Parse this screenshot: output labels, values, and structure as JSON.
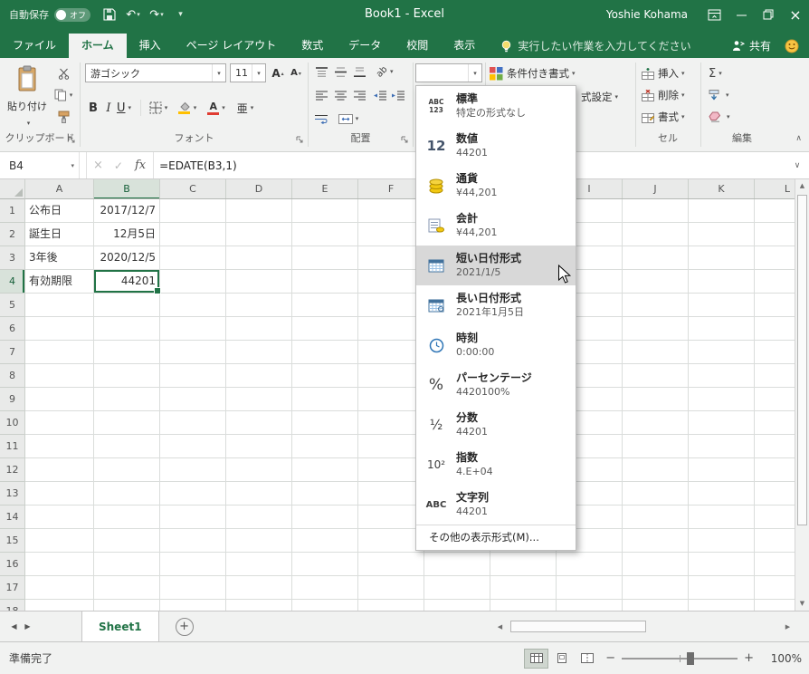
{
  "colors": {
    "excel_green": "#217346",
    "ribbon_bg": "#f1f2f1",
    "menu_highlight": "#d8d8d8",
    "selected_header_bg": "#d8e2da",
    "selected_cell_border": "#217346",
    "grid_line": "#dadddb"
  },
  "title_bar": {
    "autosave_label": "自動保存",
    "autosave_state": "オフ",
    "title": "Book1 - Excel",
    "user_name": "Yoshie Kohama"
  },
  "ribbon_tabs": {
    "file": "ファイル",
    "tabs": [
      "ホーム",
      "挿入",
      "ページ レイアウト",
      "数式",
      "データ",
      "校閲",
      "表示"
    ],
    "active_tab": "ホーム",
    "tell_me": "実行したい作業を入力してください",
    "share": "共有"
  },
  "ribbon": {
    "clipboard": {
      "group_label": "クリップボード",
      "paste_label": "貼り付け"
    },
    "font": {
      "group_label": "フォント",
      "font_name": "游ゴシック",
      "font_size": "11",
      "bold": "B",
      "italic": "I",
      "underline": "U",
      "phonetic": "亜"
    },
    "alignment": {
      "group_label": "配置",
      "orientation": "ab"
    },
    "number": {
      "format_value": ""
    },
    "styles": {
      "conditional_formatting": "条件付き書式",
      "format_as_table_truncated": "式設定"
    },
    "cells": {
      "group_label": "セル",
      "insert": "挿入",
      "delete": "削除",
      "format": "書式"
    },
    "editing": {
      "group_label": "編集",
      "autosum": "Σ"
    },
    "collapse": "∧"
  },
  "formula_bar": {
    "name_box": "B4",
    "fx": "fx",
    "formula": "=EDATE(B3,1)"
  },
  "grid": {
    "columns": [
      "A",
      "B",
      "C",
      "D",
      "E",
      "F",
      "G",
      "H",
      "I",
      "J",
      "K",
      "L"
    ],
    "visible_rows": 18,
    "selected_cell": "B4",
    "selected_column": "B",
    "selected_row": 4,
    "cells": {
      "A1": "公布日",
      "B1": "2017/12/7",
      "A2": "誕生日",
      "B2": "12月5日",
      "A3": "3年後",
      "B3": "2020/12/5",
      "A4": "有効期限",
      "B4": "44201"
    },
    "right_aligned": [
      "B1",
      "B2",
      "B3",
      "B4"
    ]
  },
  "number_format_menu": {
    "items": [
      {
        "icon": "general-icon",
        "glyph": "ABC\n123",
        "title": "標準",
        "example": "特定の形式なし",
        "highlighted": false
      },
      {
        "icon": "number-icon",
        "glyph": "12",
        "title": "数値",
        "example": "44201",
        "highlighted": false
      },
      {
        "icon": "currency-icon",
        "glyph": "",
        "title": "通貨",
        "example": "¥44,201",
        "highlighted": false
      },
      {
        "icon": "accounting-icon",
        "glyph": "",
        "title": "会計",
        "example": "¥44,201",
        "highlighted": false
      },
      {
        "icon": "short-date-icon",
        "glyph": "",
        "title": "短い日付形式",
        "example": "2021/1/5",
        "highlighted": true
      },
      {
        "icon": "long-date-icon",
        "glyph": "",
        "title": "長い日付形式",
        "example": "2021年1月5日",
        "highlighted": false
      },
      {
        "icon": "time-icon",
        "glyph": "",
        "title": "時刻",
        "example": "0:00:00",
        "highlighted": false
      },
      {
        "icon": "percentage-icon",
        "glyph": "%",
        "title": "パーセンテージ",
        "example": "4420100%",
        "highlighted": false
      },
      {
        "icon": "fraction-icon",
        "glyph": "½",
        "title": "分数",
        "example": "44201",
        "highlighted": false
      },
      {
        "icon": "scientific-icon",
        "glyph": "10²",
        "title": "指数",
        "example": "4.E+04",
        "highlighted": false
      },
      {
        "icon": "text-icon",
        "glyph": "ABC",
        "title": "文字列",
        "example": "44201",
        "highlighted": false
      }
    ],
    "more_formats": "その他の表示形式(M)..."
  },
  "sheet_tabs": {
    "tabs": [
      {
        "label": "Sheet1",
        "active": true
      }
    ],
    "add_sheet": "+"
  },
  "status_bar": {
    "status": "準備完了",
    "zoom_level": "100%"
  }
}
